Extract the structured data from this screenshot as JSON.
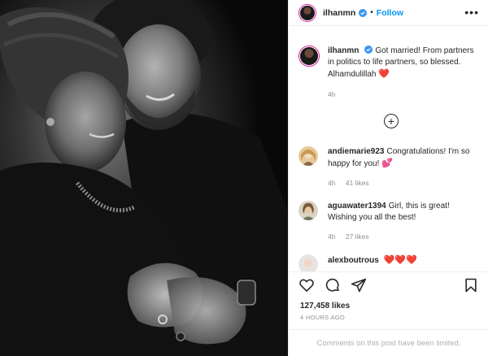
{
  "header": {
    "username": "ilhanmn",
    "separator": "•",
    "follow_label": "Follow",
    "more_label": "•••"
  },
  "caption": {
    "username": "ilhanmn",
    "text": "Got married! From partners in politics to life partners, so blessed. Alhamdulillah",
    "emoji": "❤️",
    "time": "4h"
  },
  "load_more_label": "+",
  "comments": [
    {
      "username": "andiemarie923",
      "text": "Congratulations! I'm so happy for you!",
      "emoji": "💕",
      "time": "4h",
      "likes": "41 likes"
    },
    {
      "username": "aguawater1394",
      "text": "Girl, this is great! Wishing you all the best!",
      "emoji": "",
      "time": "4h",
      "likes": "27 likes"
    },
    {
      "username": "alexboutrous",
      "text": "",
      "emoji": "❤️❤️❤️",
      "time": "",
      "likes": ""
    }
  ],
  "actions": {
    "icons": [
      "heart-icon",
      "comment-icon",
      "share-icon",
      "bookmark-icon"
    ],
    "likes_count": "127,458 likes",
    "posted_time": "4 HOURS AGO",
    "limited_text": "Comments on this post have been limited."
  },
  "colors": {
    "follow_blue": "#0095f6",
    "verified_blue": "#3897f0",
    "text_primary": "#262626",
    "text_secondary": "#8e8e8e",
    "heart_red": "#d71e3b"
  }
}
